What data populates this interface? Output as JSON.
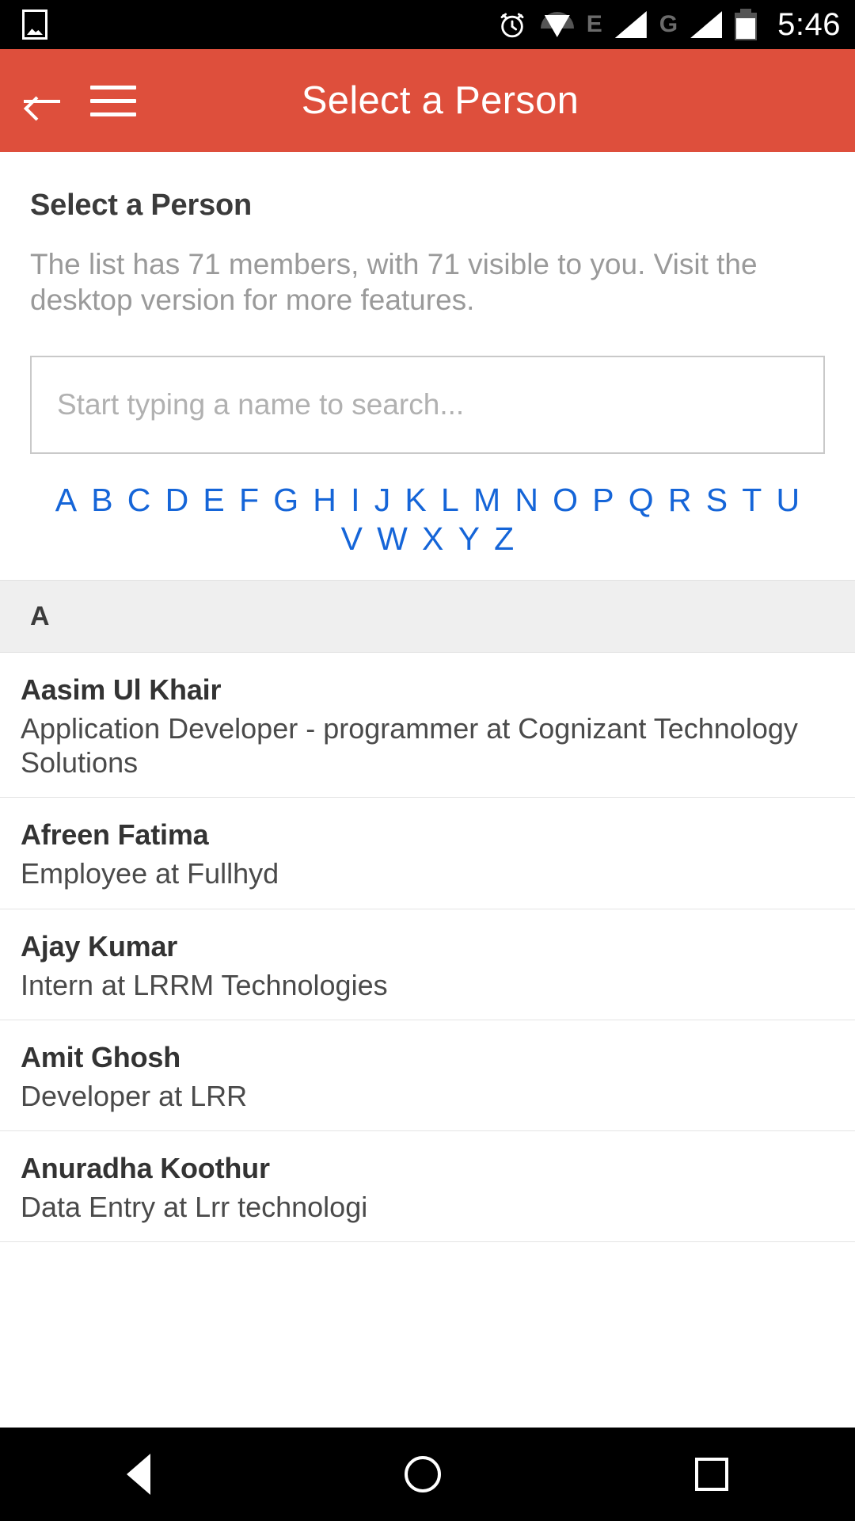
{
  "status_bar": {
    "image_icon": "image-icon",
    "alarm_icon": "alarm-icon",
    "wifi_icon": "wifi-icon",
    "network_1": "E",
    "network_2": "G",
    "battery_icon": "battery-icon",
    "time": "5:46"
  },
  "app_bar": {
    "back_label": "back-arrow",
    "menu_label": "hamburger-menu",
    "title": "Select a Person"
  },
  "main": {
    "page_title": "Select a Person",
    "description": "The list has 71 members, with 71 visible to you. Visit the desktop version for more features.",
    "member_count": 71,
    "visible_count": 71,
    "search": {
      "placeholder": "Start typing a name to search...",
      "value": ""
    },
    "alphabet_index": [
      "A",
      "B",
      "C",
      "D",
      "E",
      "F",
      "G",
      "H",
      "I",
      "J",
      "K",
      "L",
      "M",
      "N",
      "O",
      "P",
      "Q",
      "R",
      "S",
      "T",
      "U",
      "V",
      "W",
      "X",
      "Y",
      "Z"
    ],
    "section_letter": "A",
    "people": [
      {
        "name": "Aasim Ul Khair",
        "role": "Application Developer - programmer at Cognizant Technology Solutions"
      },
      {
        "name": "Afreen Fatima",
        "role": "Employee at Fullhyd"
      },
      {
        "name": "Ajay Kumar",
        "role": "Intern at LRRM Technologies"
      },
      {
        "name": "Amit Ghosh",
        "role": "Developer at LRR"
      },
      {
        "name": "Anuradha Koothur",
        "role": "Data Entry at Lrr technologi"
      }
    ]
  },
  "nav_bar": {
    "back": "back-triangle-icon",
    "home": "home-circle-icon",
    "recents": "recents-square-icon"
  },
  "colors": {
    "accent": "#de4f3c",
    "link": "#1565d8",
    "section_bg": "#efefef"
  }
}
